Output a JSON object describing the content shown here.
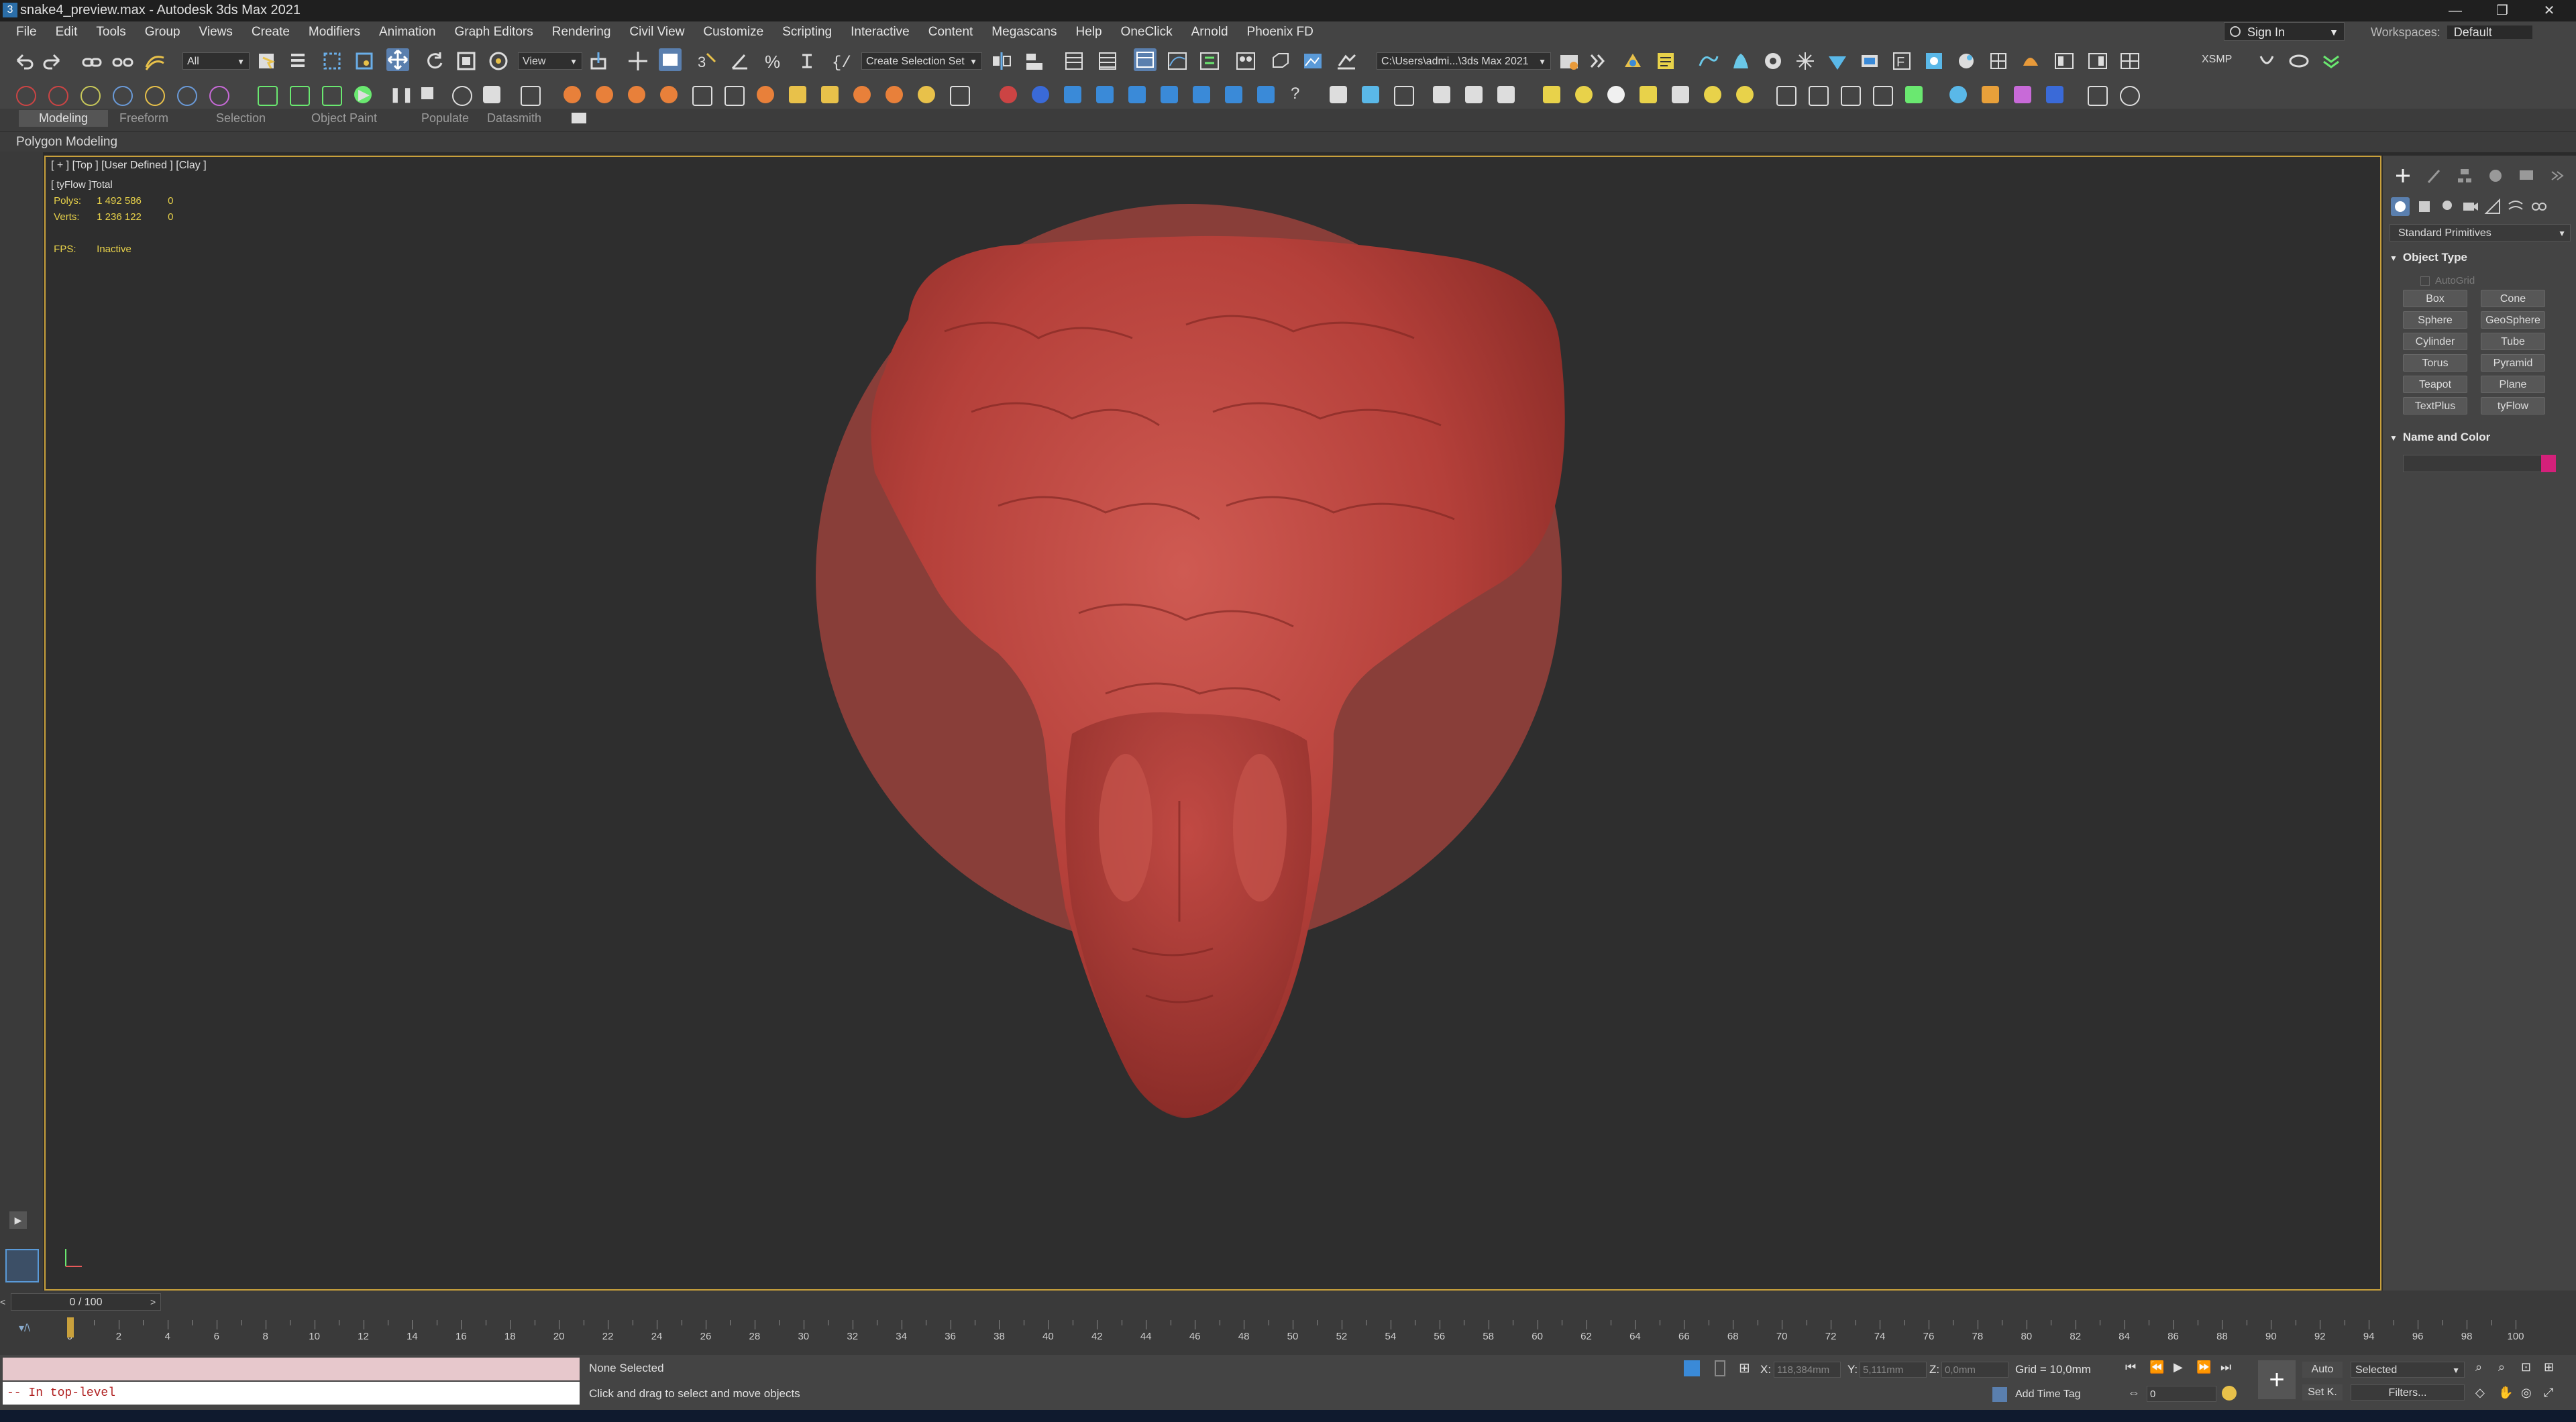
{
  "window": {
    "title": "snake4_preview.max - Autodesk 3ds Max 2021",
    "minimize": "—",
    "restore": "❐",
    "close": "✕"
  },
  "menu": [
    "File",
    "Edit",
    "Tools",
    "Group",
    "Views",
    "Create",
    "Modifiers",
    "Animation",
    "Graph Editors",
    "Rendering",
    "Civil View",
    "Customize",
    "Scripting",
    "Interactive",
    "Content",
    "Megascans",
    "Help",
    "OneClick",
    "Arnold",
    "Phoenix FD"
  ],
  "signin": "Sign In",
  "workspaces": {
    "label": "Workspaces:",
    "value": "Default"
  },
  "toolbar": {
    "filter": "All",
    "refcoord": "View",
    "selection_set": "Create Selection Set",
    "path": "C:\\Users\\admi...\\3ds Max 2021",
    "xsmp": "XSMP"
  },
  "ribbon": {
    "tabs": [
      "Modeling",
      "Freeform",
      "Selection",
      "Object Paint",
      "Populate",
      "Datasmith"
    ],
    "active": "Modeling",
    "subtitle": "Polygon Modeling"
  },
  "viewport": {
    "label": "[ + ] [Top ] [User Defined ] [Clay ]",
    "stats": {
      "header_a": "tyFlow",
      "header_b": "Total",
      "polys_label": "Polys:",
      "polys_value": "1 492 586",
      "polys_extra": "0",
      "verts_label": "Verts:",
      "verts_value": "1 236 122",
      "verts_extra": "0",
      "fps_label": "FPS:",
      "fps_value": "Inactive"
    },
    "model_color": "#b5403a"
  },
  "command_panel": {
    "category": "Standard Primitives",
    "object_type_heading": "Object Type",
    "autogrid": "AutoGrid",
    "primitives": [
      "Box",
      "Cone",
      "Sphere",
      "GeoSphere",
      "Cylinder",
      "Tube",
      "Torus",
      "Pyramid",
      "Teapot",
      "Plane",
      "TextPlus",
      "tyFlow"
    ],
    "name_color_heading": "Name and Color",
    "swatch_color": "#d4207a"
  },
  "timeline": {
    "frame_display": "0 / 100",
    "ticks": [
      0,
      2,
      4,
      6,
      8,
      10,
      12,
      14,
      16,
      18,
      20,
      22,
      24,
      26,
      28,
      30,
      32,
      34,
      36,
      38,
      40,
      42,
      44,
      46,
      48,
      50,
      52,
      54,
      56,
      58,
      60,
      62,
      64,
      66,
      68,
      70,
      72,
      74,
      76,
      78,
      80,
      82,
      84,
      86,
      88,
      90,
      92,
      94,
      96,
      98,
      100
    ]
  },
  "status": {
    "maxscript_output": "-- In top-level",
    "selection": "None Selected",
    "prompt": "Click and drag to select and move objects",
    "x_label": "X:",
    "x_value": "118,384mm",
    "y_label": "Y:",
    "y_value": "5,111mm",
    "z_label": "Z:",
    "z_value": "0,0mm",
    "grid": "Grid = 10,0mm",
    "add_time_tag": "Add Time Tag",
    "auto": "Auto",
    "set_key": "Set K.",
    "selected": "Selected",
    "filters": "Filters...",
    "frame": "0"
  }
}
